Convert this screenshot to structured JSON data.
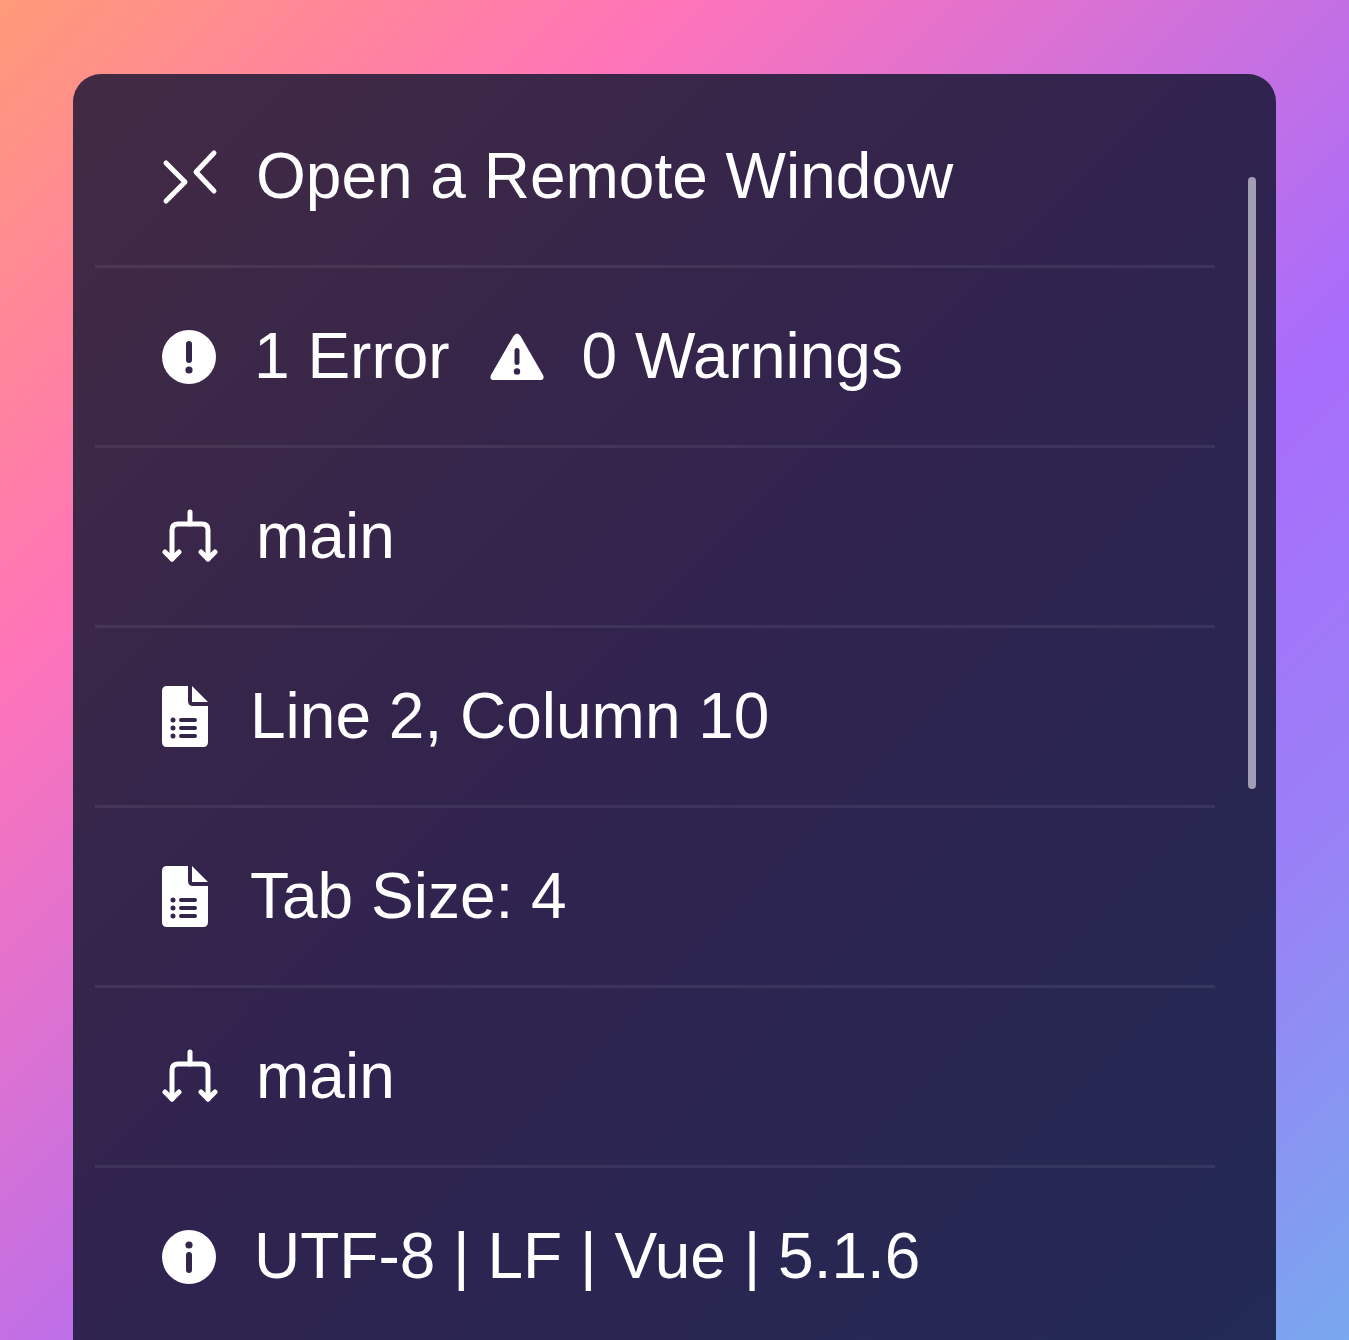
{
  "status_items": [
    {
      "kind": "remote",
      "label": "Open a Remote Window"
    },
    {
      "kind": "problems",
      "errors": "1 Error",
      "warnings": "0 Warnings"
    },
    {
      "kind": "branch",
      "label": "main"
    },
    {
      "kind": "file",
      "label": "Line 2, Column 10"
    },
    {
      "kind": "file",
      "label": "Tab Size: 4"
    },
    {
      "kind": "branch",
      "label": "main"
    },
    {
      "kind": "info",
      "label": "UTF-8 | LF | Vue | 5.1.6"
    }
  ]
}
